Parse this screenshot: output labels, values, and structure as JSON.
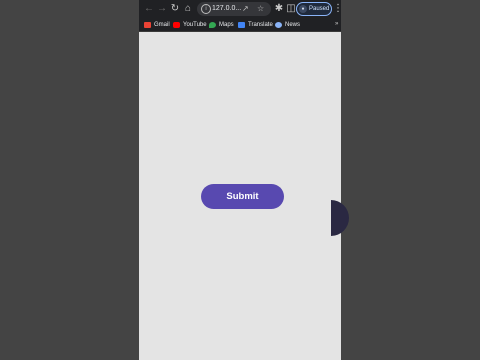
{
  "browser": {
    "url": "127.0.0...",
    "profile_status": "Paused",
    "nav_icons": [
      "arrow-left-icon",
      "arrow-right-icon",
      "reload-icon",
      "home-icon"
    ],
    "bookmarks": [
      {
        "label": "Gmail",
        "icon": "gmail-icon",
        "color": "#ea4335"
      },
      {
        "label": "YouTube",
        "icon": "youtube-icon",
        "color": "#ff0000"
      },
      {
        "label": "Maps",
        "icon": "maps-icon",
        "color": "#34a853"
      },
      {
        "label": "Translate",
        "icon": "translate-icon",
        "color": "#4285f4"
      },
      {
        "label": "News",
        "icon": "news-icon",
        "color": "#8ab4f8"
      }
    ],
    "bookmarks_overflow": "»"
  },
  "page": {
    "background": "#e4e4e4",
    "submit_label": "Submit",
    "accent": "#5849b0"
  }
}
